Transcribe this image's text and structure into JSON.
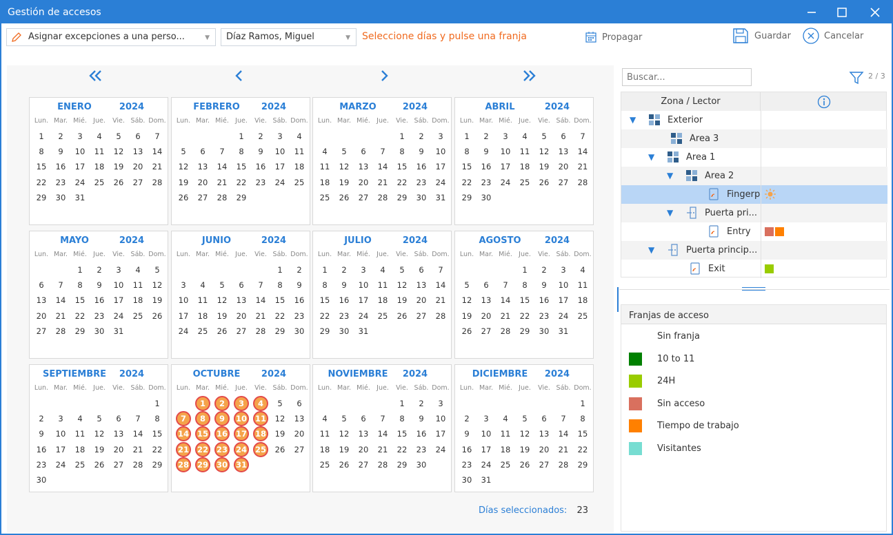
{
  "window": {
    "title": "Gestión de accesos"
  },
  "toolbar": {
    "mode_value": "Asignar excepciones a una perso...",
    "person_value": "Díaz Ramos, Miguel",
    "hint": "Seleccione días y pulse una franja",
    "propagate_label": "Propagar",
    "save_label": "Guardar",
    "cancel_label": "Cancelar"
  },
  "calendar": {
    "weekdays": [
      "Lun.",
      "Mar.",
      "Mié.",
      "Jue.",
      "Vie.",
      "Sáb.",
      "Dom."
    ],
    "months": [
      {
        "name": "ENERO",
        "year": "2024",
        "offset": 0,
        "days": 31,
        "selected": []
      },
      {
        "name": "FEBRERO",
        "year": "2024",
        "offset": 3,
        "days": 29,
        "selected": []
      },
      {
        "name": "MARZO",
        "year": "2024",
        "offset": 4,
        "days": 31,
        "selected": []
      },
      {
        "name": "ABRIL",
        "year": "2024",
        "offset": 0,
        "days": 30,
        "selected": []
      },
      {
        "name": "MAYO",
        "year": "2024",
        "offset": 2,
        "days": 31,
        "selected": []
      },
      {
        "name": "JUNIO",
        "year": "2024",
        "offset": 5,
        "days": 30,
        "selected": []
      },
      {
        "name": "JULIO",
        "year": "2024",
        "offset": 0,
        "days": 31,
        "selected": []
      },
      {
        "name": "AGOSTO",
        "year": "2024",
        "offset": 3,
        "days": 31,
        "selected": []
      },
      {
        "name": "SEPTIEMBRE",
        "year": "2024",
        "offset": 6,
        "days": 30,
        "selected": []
      },
      {
        "name": "OCTUBRE",
        "year": "2024",
        "offset": 1,
        "days": 31,
        "selected": [
          1,
          2,
          3,
          4,
          7,
          8,
          9,
          10,
          11,
          14,
          15,
          16,
          17,
          18,
          21,
          22,
          23,
          24,
          25,
          28,
          29,
          30,
          31
        ]
      },
      {
        "name": "NOVIEMBRE",
        "year": "2024",
        "offset": 4,
        "days": 30,
        "selected": []
      },
      {
        "name": "DICIEMBRE",
        "year": "2024",
        "offset": 6,
        "days": 31,
        "selected": []
      }
    ],
    "selected_days_label": "Días seleccionados:",
    "selected_days_count": "23"
  },
  "tree": {
    "search_placeholder": "Buscar...",
    "filter_count": "2 / 3",
    "col_zone": "Zona / Lector",
    "rows": [
      {
        "label": "Exterior",
        "icon": "zone-icon",
        "expanded": true,
        "swatches": []
      },
      {
        "label": "Área 3",
        "icon": "zone-icon",
        "expanded": false,
        "swatches": []
      },
      {
        "label": "Área 1",
        "icon": "zone-icon",
        "expanded": true,
        "swatches": []
      },
      {
        "label": "Área 2",
        "icon": "zone-icon",
        "expanded": true,
        "swatches": []
      },
      {
        "label": "Fingerprin...",
        "icon": "reader-icon",
        "expanded": false,
        "selected": true,
        "swatches": [
          "sun"
        ]
      },
      {
        "label": "Puerta pri...",
        "icon": "door-icon",
        "expanded": true,
        "swatches": []
      },
      {
        "label": "Entry",
        "icon": "reader-icon",
        "expanded": false,
        "swatches": [
          "#d9705e",
          "#ff8000"
        ]
      },
      {
        "label": "Puerta princip...",
        "icon": "door-icon",
        "expanded": true,
        "swatches": []
      },
      {
        "label": "Exit",
        "icon": "reader-icon",
        "expanded": false,
        "swatches": [
          "#99cc00"
        ]
      }
    ]
  },
  "franjas": {
    "title": "Franjas de acceso",
    "items": [
      {
        "label": "Sin franja",
        "color": ""
      },
      {
        "label": "10 to 11",
        "color": "#008000"
      },
      {
        "label": "24H",
        "color": "#99cc00"
      },
      {
        "label": "Sin acceso",
        "color": "#d9705e"
      },
      {
        "label": "Tiempo de trabajo",
        "color": "#ff8000"
      },
      {
        "label": "Visitantes",
        "color": "#77ddd2"
      }
    ]
  }
}
